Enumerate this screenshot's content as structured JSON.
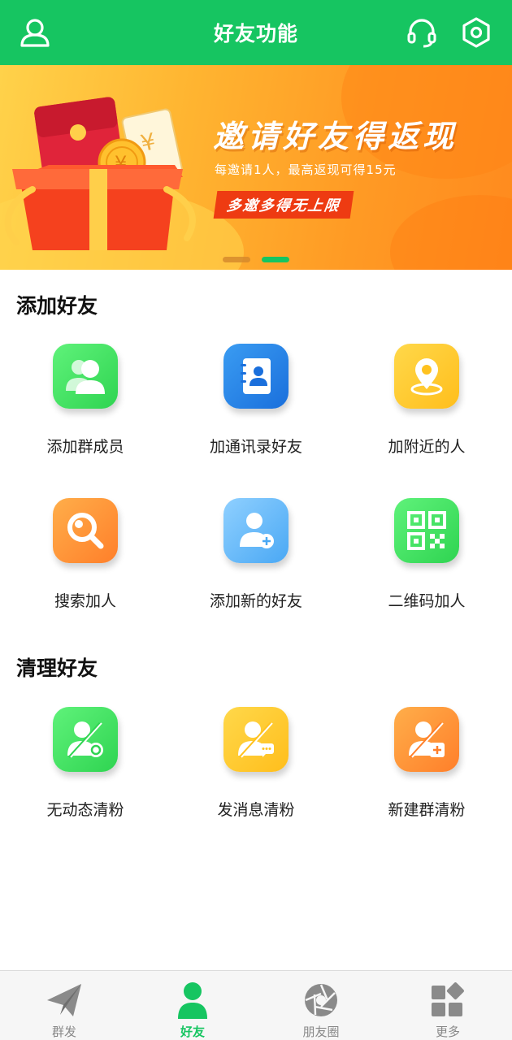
{
  "header": {
    "title": "好友功能",
    "left_icon": "user-icon",
    "right_icons": [
      "headset-icon",
      "settings-hex-icon"
    ]
  },
  "banner": {
    "title": "邀请好友得返现",
    "subtitle": "每邀请1人，最高返现可得15元",
    "tag": "多邀多得无上限",
    "active_slide": 2,
    "slide_count": 2
  },
  "sections": {
    "add": {
      "title": "添加好友",
      "items": [
        {
          "label": "添加群成员",
          "icon": "group-members-icon"
        },
        {
          "label": "加通讯录好友",
          "icon": "contacts-book-icon"
        },
        {
          "label": "加附近的人",
          "icon": "location-pin-icon"
        },
        {
          "label": "搜索加人",
          "icon": "search-icon"
        },
        {
          "label": "添加新的好友",
          "icon": "add-user-icon"
        },
        {
          "label": "二维码加人",
          "icon": "qr-code-icon"
        }
      ]
    },
    "clean": {
      "title": "清理好友",
      "items": [
        {
          "label": "无动态清粉",
          "icon": "user-no-moments-icon"
        },
        {
          "label": "发消息清粉",
          "icon": "user-message-icon"
        },
        {
          "label": "新建群清粉",
          "icon": "user-new-group-icon"
        }
      ]
    }
  },
  "bottom_nav": {
    "active": "好友",
    "items": [
      {
        "label": "群发",
        "icon": "paper-plane-icon"
      },
      {
        "label": "好友",
        "icon": "person-icon"
      },
      {
        "label": "朋友圈",
        "icon": "aperture-icon"
      },
      {
        "label": "更多",
        "icon": "apps-grid-icon"
      }
    ]
  },
  "colors": {
    "primary": "#16c561",
    "nav_inactive": "#888888",
    "banner_tag": "#ee3b12"
  }
}
